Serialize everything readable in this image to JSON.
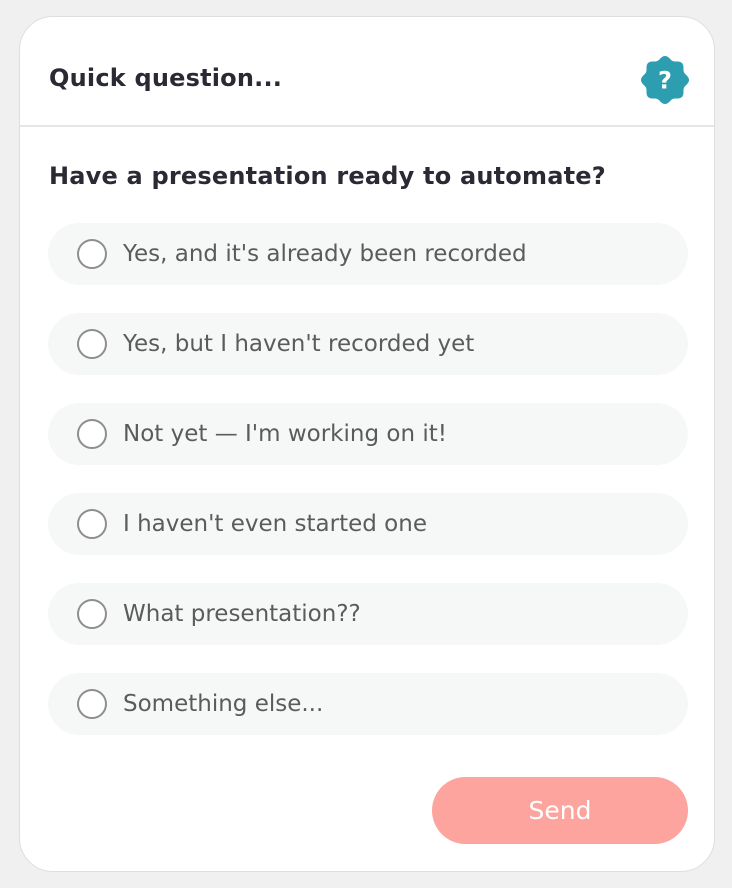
{
  "header": {
    "title": "Quick question...",
    "help_icon": "question-badge-icon",
    "help_icon_color": "#2d9db0"
  },
  "question": "Have a presentation ready to automate?",
  "options": [
    {
      "label": "Yes, and it's already been recorded",
      "selected": false
    },
    {
      "label": "Yes, but I haven't recorded yet",
      "selected": false
    },
    {
      "label": "Not yet — I'm working on it!",
      "selected": false
    },
    {
      "label": "I haven't even started one",
      "selected": false
    },
    {
      "label": "What presentation??",
      "selected": false
    },
    {
      "label": "Something else...",
      "selected": false
    }
  ],
  "send_button": {
    "label": "Send",
    "color": "#fda49e",
    "enabled": false
  }
}
